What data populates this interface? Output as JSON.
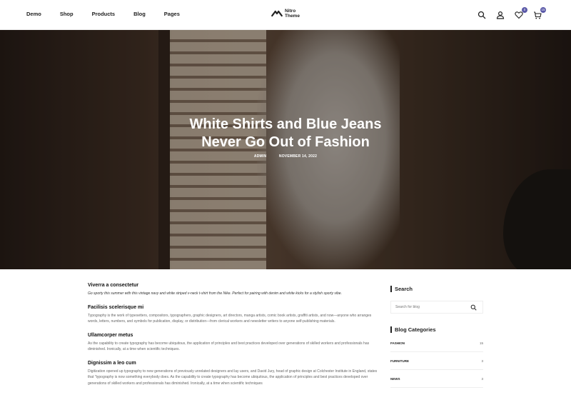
{
  "nav": {
    "items": [
      {
        "label": "Demo"
      },
      {
        "label": "Shop"
      },
      {
        "label": "Products"
      },
      {
        "label": "Blog"
      },
      {
        "label": "Pages"
      }
    ]
  },
  "logo": {
    "line1": "Nitro",
    "line2": "Theme"
  },
  "header_icons": {
    "wishlist_count": "0",
    "cart_count": "15"
  },
  "hero": {
    "title_line1": "White Shirts and Blue Jeans",
    "title_line2": "Never Go Out of Fashion",
    "author": "ADMIN",
    "date": "NOVEMBER 14, 2022"
  },
  "article": {
    "h1": "Viverra a consectetur",
    "p1": "Go sporty this summer with this vintage navy and white striped v-neck t-shirt from the Nike. Perfect for pairing with denim and white kicks for a stylish sporty vibe.",
    "h2": "Facilisis scelerisque mi",
    "p2": "Typography is the work of typesetters, compositors, typographers, graphic designers, art directors, manga artists, comic book artists, graffiti artists, and now—anyone who arranges words, letters, numbers, and symbols for publication, display, or distribution—from clerical workers and newsletter writers to anyone self-publishing materials.",
    "h3": "Ullamcorper metus",
    "p3": "As the capability to create typography has become ubiquitous, the application of principles and best practices developed over generations of skilled workers and professionals has diminished. Ironically, at a time when scientific techniques.",
    "h4": "Dignissim a leo cum",
    "p4": "Digitization opened up typography to new generations of previously unrelated designers and lay users, and David Jury, head of graphic design at Colchester Institute in England, states that \"typography is now something everybody does. As the capability to create typography has become ubiquitous, the application of principles and best practices developed over generations of skilled workers and professionals has diminished. Ironically, at a time when scientific techniques"
  },
  "sidebar": {
    "search_title": "Search",
    "search_placeholder": "Search for blog",
    "categories_title": "Blog Categories",
    "categories": [
      {
        "name": "FASHION",
        "count": "15"
      },
      {
        "name": "FURNITURE",
        "count": "3"
      },
      {
        "name": "NEWS",
        "count": "3"
      }
    ]
  }
}
